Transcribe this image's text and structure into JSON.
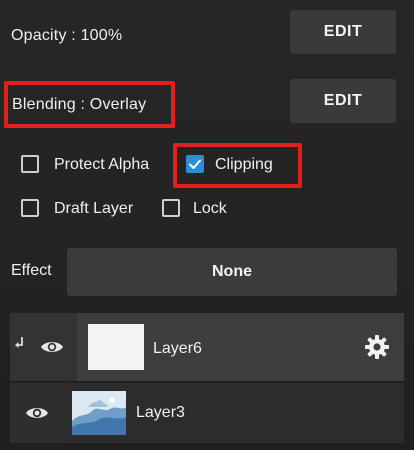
{
  "opacity": {
    "label": "Opacity : 100%",
    "edit_label": "EDIT"
  },
  "blending": {
    "label": "Blending : Overlay",
    "edit_label": "EDIT"
  },
  "options": {
    "protect_alpha": {
      "label": "Protect Alpha",
      "checked": false
    },
    "clipping": {
      "label": "Clipping",
      "checked": true
    },
    "draft_layer": {
      "label": "Draft Layer",
      "checked": false
    },
    "lock": {
      "label": "Lock",
      "checked": false
    }
  },
  "effect": {
    "label": "Effect",
    "value": "None"
  },
  "layers": [
    {
      "name": "Layer6",
      "selected": true,
      "clipped": true,
      "visible": true
    },
    {
      "name": "Layer3",
      "selected": false,
      "clipped": false,
      "visible": true
    }
  ],
  "colors": {
    "highlight": "#e0201c",
    "checkbox_accent": "#2a8fd8",
    "button_bg": "#3a3a3a",
    "panel_bg": "#232323"
  },
  "icons": {
    "visibility": "eye-icon",
    "clip": "clip-arrow-icon",
    "settings": "gear-icon",
    "check": "checkmark-icon"
  }
}
